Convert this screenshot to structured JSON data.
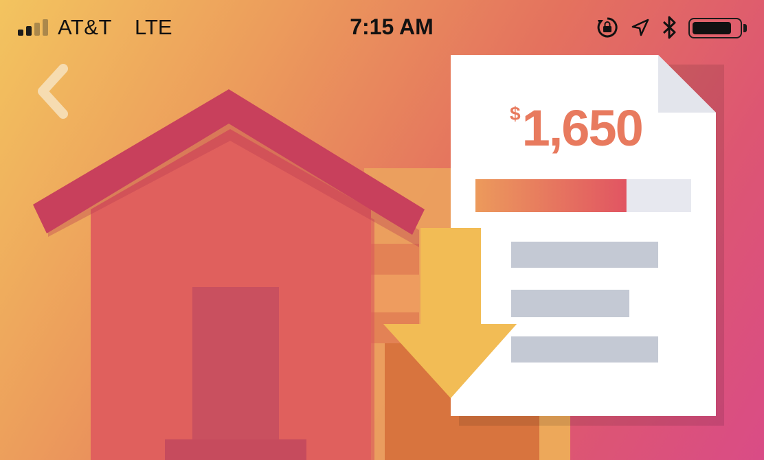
{
  "status_bar": {
    "carrier": "AT&T",
    "network": "LTE",
    "time": "7:15 AM",
    "signal_bars_active": 2,
    "signal_bars_total": 4,
    "battery_level": 0.85,
    "icons": [
      "signal-icon",
      "rotation-lock-icon",
      "location-arrow-icon",
      "bluetooth-icon",
      "battery-icon"
    ]
  },
  "navigation": {
    "back_icon": "chevron-left-icon"
  },
  "illustration": {
    "icons": [
      "house-icon",
      "download-arrow-icon",
      "invoice-document-icon"
    ],
    "invoice": {
      "currency_symbol": "$",
      "amount": "1,650",
      "progress_fraction": 0.7
    }
  },
  "colors": {
    "gradient_start": "#f3c45f",
    "gradient_end": "#d94c86",
    "roof": "#c8405c",
    "house_body": "#e0605d",
    "door": "#c9505f",
    "arrow": "#f2bc55",
    "amount_text": "#e87a5e",
    "document": "#ffffff",
    "document_lines": "#c4c9d4"
  }
}
